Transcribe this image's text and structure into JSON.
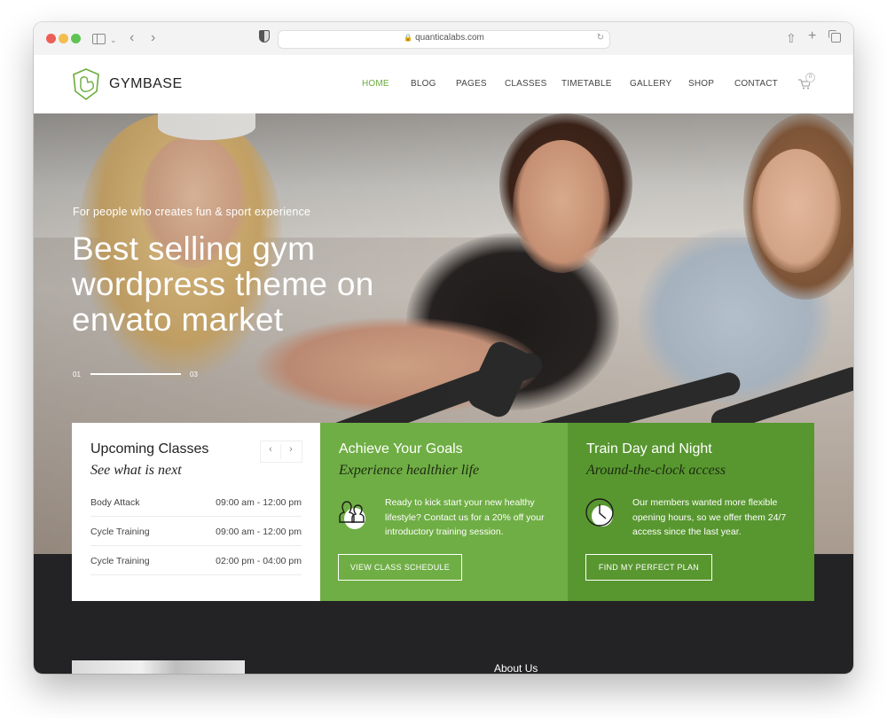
{
  "browser": {
    "url": "quanticalabs.com"
  },
  "header": {
    "brand": "GYMBASE",
    "nav": [
      {
        "label": "HOME",
        "active": true
      },
      {
        "label": "BLOG"
      },
      {
        "label": "PAGES"
      },
      {
        "label": "CLASSES"
      },
      {
        "label": "TIMETABLE"
      },
      {
        "label": "GALLERY"
      },
      {
        "label": "SHOP"
      },
      {
        "label": "CONTACT"
      }
    ],
    "cart_count": "0"
  },
  "hero": {
    "subtitle": "For people who creates fun & sport experience",
    "title": "Best selling gym wordpress theme on envato market",
    "slide_current": "01",
    "slide_total": "03"
  },
  "cards": {
    "upcoming": {
      "title": "Upcoming Classes",
      "subtitle": "See what is next",
      "classes": [
        {
          "name": "Body Attack",
          "time": "09:00 am - 12:00 pm"
        },
        {
          "name": "Cycle Training",
          "time": "09:00 am - 12:00 pm"
        },
        {
          "name": "Cycle Training",
          "time": "02:00 pm - 04:00 pm"
        }
      ]
    },
    "goals": {
      "title": "Achieve Your Goals",
      "subtitle": "Experience healthier life",
      "text": "Ready to kick start your new healthy lifestyle? Contact us for a 20% off your introductory training session.",
      "button": "VIEW CLASS SCHEDULE",
      "color": "#6fae44"
    },
    "train": {
      "title": "Train Day and Night",
      "subtitle": "Around-the-clock access",
      "text": "Our members wanted more flexible opening hours, so we offer them 24/7 access since the last year.",
      "button": "FIND MY PERFECT PLAN",
      "color": "#58972f"
    }
  },
  "footer": {
    "about_title": "About Us"
  },
  "colors": {
    "accent": "#6aac3b",
    "dark": "#232325"
  }
}
